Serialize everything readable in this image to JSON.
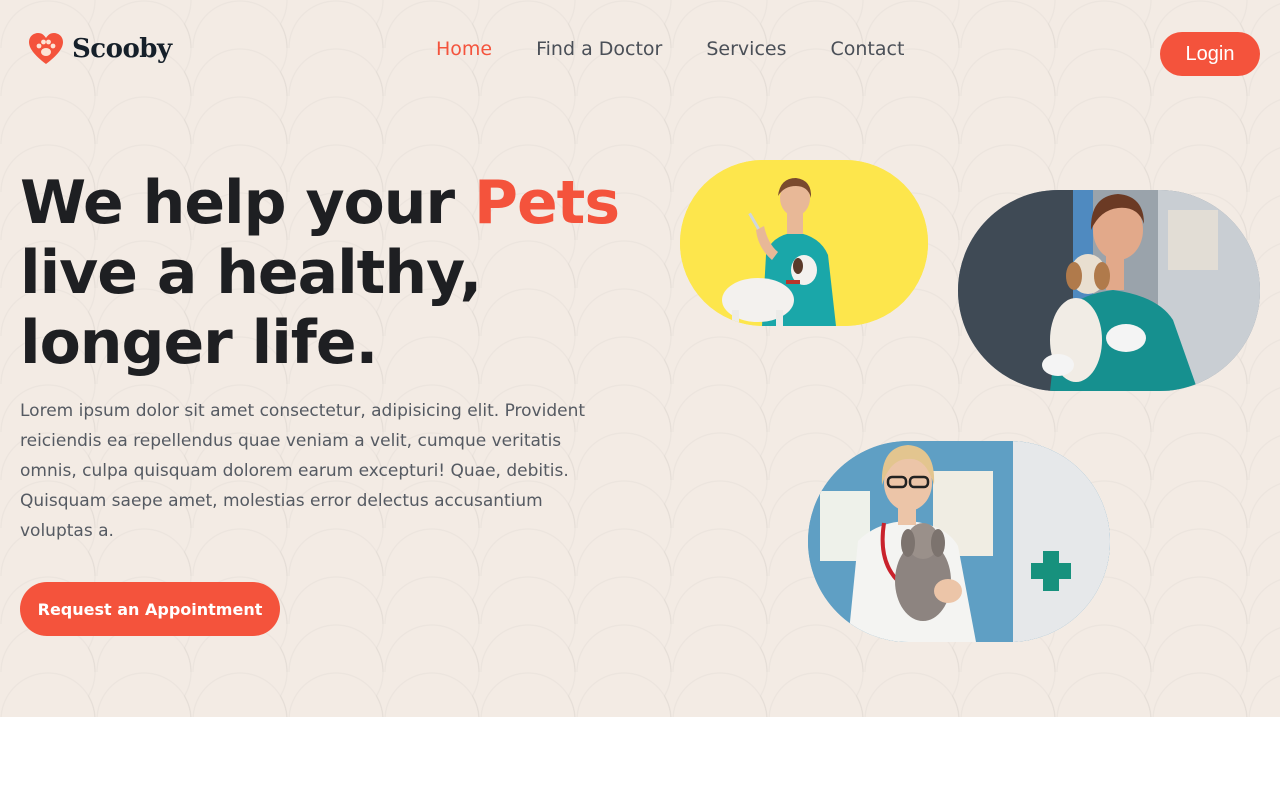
{
  "brand": {
    "name": "Scooby",
    "logo_icon": "paw-heart-icon",
    "accent_color": "#f4533c"
  },
  "nav": {
    "items": [
      {
        "label": "Home",
        "active": true
      },
      {
        "label": "Find a Doctor",
        "active": false
      },
      {
        "label": "Services",
        "active": false
      },
      {
        "label": "Contact",
        "active": false
      }
    ],
    "login_label": "Login"
  },
  "hero": {
    "headline_part1": "We help your ",
    "headline_accent": "Pets",
    "headline_part2": "live a healthy,",
    "headline_part3": "longer life.",
    "description": "Lorem ipsum dolor sit amet consectetur, adipisicing elit. Provident reiciendis ea repellendus quae veniam a velit, cumque veritatis omnis, culpa quisquam dolorem earum excepturi! Quae, debitis. Quisquam saepe amet, molestias error delectus accusantium voluptas a.",
    "cta_label": "Request an Appointment"
  },
  "images": [
    {
      "name": "vet-with-dog-yellow-photo"
    },
    {
      "name": "vet-holding-puppy-photo"
    },
    {
      "name": "vet-holding-puppy-clinic-photo"
    }
  ]
}
